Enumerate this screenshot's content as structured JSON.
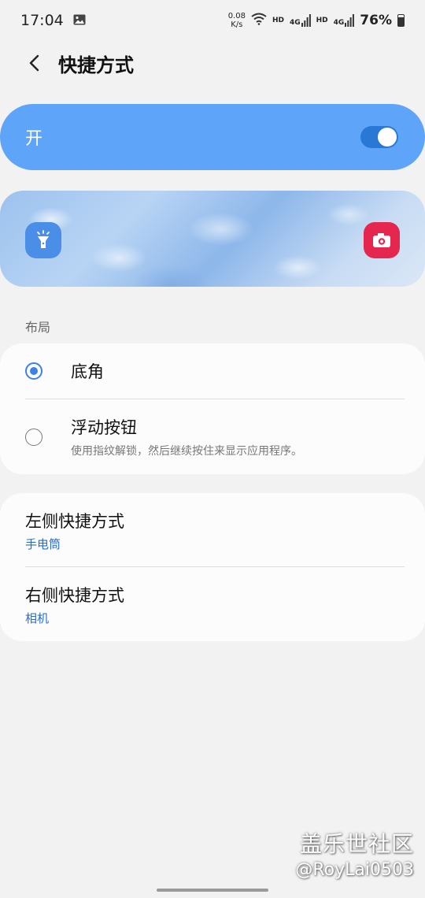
{
  "status_bar": {
    "time": "17:04",
    "net_speed_value": "0.08",
    "net_speed_unit": "K/s",
    "hd1": "HD",
    "hd2": "HD",
    "net_type1": "4G",
    "net_type2": "4G",
    "battery": "76%",
    "battery_level_percent": 76
  },
  "app_bar": {
    "title": "快捷方式"
  },
  "master_switch": {
    "label": "开",
    "state": "on"
  },
  "preview": {
    "left_icon": "flashlight-icon",
    "right_icon": "camera-icon"
  },
  "layout_section": {
    "header": "布局",
    "options": [
      {
        "label": "底角",
        "selected": true
      },
      {
        "label": "浮动按钮",
        "sublabel": "使用指纹解锁，然后继续按住来显示应用程序。",
        "selected": false
      }
    ]
  },
  "shortcuts": [
    {
      "title": "左侧快捷方式",
      "value": "手电筒"
    },
    {
      "title": "右侧快捷方式",
      "value": "相机"
    }
  ],
  "watermark": {
    "line1": "盖乐世社区",
    "line2": "@RoyLai0503"
  },
  "colors": {
    "accent": "#5ea4f8",
    "toggle_track": "#2978d6",
    "radio_checked": "#3b82e4",
    "link_value": "#2a6dc0",
    "camera_bg": "#e5264f",
    "flashlight_bg": "#4b8ee8"
  }
}
